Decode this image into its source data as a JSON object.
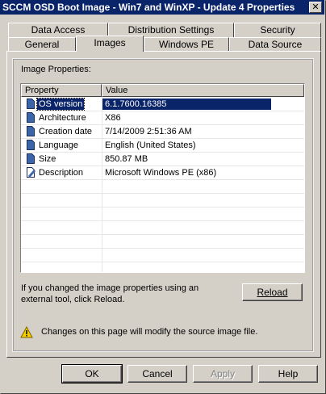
{
  "window": {
    "title": "SCCM OSD Boot Image - Win7 and WinXP - Update 4 Properties",
    "close_glyph": "✕"
  },
  "tabs_back": [
    "Data Access",
    "Distribution Settings",
    "Security"
  ],
  "tabs_front": [
    "General",
    "Images",
    "Windows PE",
    "Data Source"
  ],
  "active_tab": "Images",
  "images": {
    "section_label": "Image Properties:",
    "columns": [
      "Property",
      "Value"
    ],
    "rows": [
      {
        "property": "OS version",
        "value": "6.1.7600.16385",
        "icon": "document-icon",
        "selected": true
      },
      {
        "property": "Architecture",
        "value": "X86",
        "icon": "document-icon"
      },
      {
        "property": "Creation date",
        "value": "7/14/2009 2:51:36 AM",
        "icon": "document-icon"
      },
      {
        "property": "Language",
        "value": "English (United States)",
        "icon": "document-icon"
      },
      {
        "property": "Size",
        "value": "850.87 MB",
        "icon": "document-icon"
      },
      {
        "property": "Description",
        "value": "Microsoft Windows PE (x86)",
        "icon": "edit-document-icon"
      }
    ],
    "reload_hint_line1": "If you changed the image properties using an",
    "reload_hint_line2": "external tool, click Reload.",
    "reload_label": "Reload",
    "warning_text": "Changes on this page will modify the source image file."
  },
  "footer": {
    "ok_label": "OK",
    "cancel_label": "Cancel",
    "apply_label": "Apply",
    "help_label": "Help"
  }
}
